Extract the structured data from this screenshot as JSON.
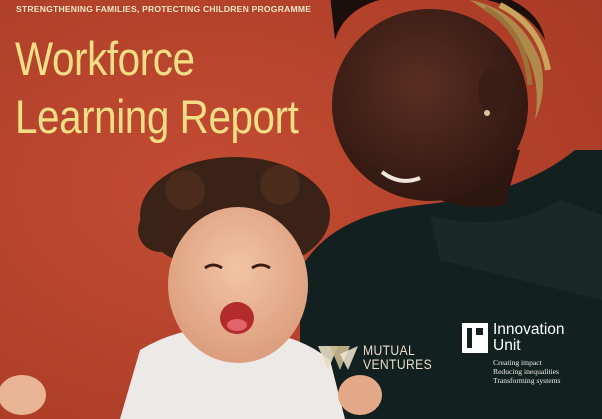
{
  "cover": {
    "kicker": "STRENGTHENING FAMILIES, PROTECTING CHILDREN PROGRAMME",
    "title_line1": "Workforce",
    "title_line2": "Learning Report",
    "background_color": "#b8432c",
    "title_color": "#f3de86"
  },
  "logos": {
    "mutual_ventures": {
      "line1": "MUTUAL",
      "line2": "VENTURES",
      "icon": "mutual-ventures-mark"
    },
    "innovation_unit": {
      "name_line1": "Innovation",
      "name_line2": "Unit",
      "tagline1": "Creating impact",
      "tagline2": "Reducing inequalities",
      "tagline3": "Transforming systems",
      "icon": "innovation-unit-mark"
    }
  },
  "photo": {
    "icon": "cover-photo-adult-holding-laughing-baby"
  }
}
